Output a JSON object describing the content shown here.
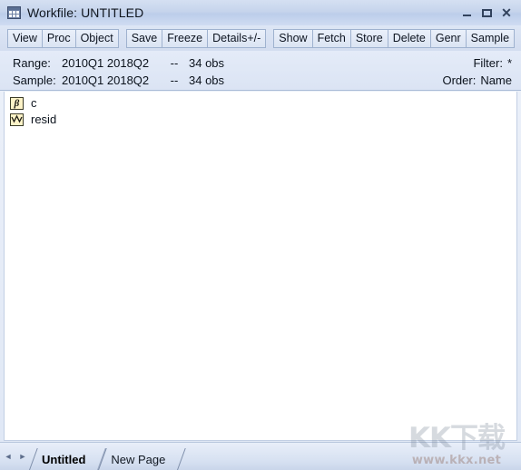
{
  "window": {
    "title": "Workfile: UNTITLED",
    "icon": "workfile-grid-icon",
    "buttons": {
      "minimize": "minimize-icon",
      "maximize": "maximize-icon",
      "close": "close-icon"
    }
  },
  "toolbar": {
    "groups": [
      {
        "buttons": [
          "View",
          "Proc",
          "Object"
        ]
      },
      {
        "buttons": [
          "Save",
          "Freeze",
          "Details+/-"
        ]
      },
      {
        "buttons": [
          "Show",
          "Fetch",
          "Store",
          "Delete",
          "Genr",
          "Sample"
        ]
      }
    ]
  },
  "info": {
    "range": {
      "label": "Range:",
      "dates": "2010Q1 2018Q2",
      "dash": "--",
      "obs": "34 obs"
    },
    "sample": {
      "label": "Sample:",
      "dates": "2010Q1 2018Q2",
      "dash": "--",
      "obs": "34 obs"
    },
    "filter": {
      "label": "Filter:",
      "value": "*"
    },
    "order": {
      "label": "Order:",
      "value": "Name"
    }
  },
  "objects": [
    {
      "name": "c",
      "icon": "coefficient-beta-icon",
      "glyph": "β"
    },
    {
      "name": "resid",
      "icon": "series-line-icon",
      "glyph": ""
    }
  ],
  "tabs": {
    "nav_prev": "◄",
    "nav_next": "►",
    "items": [
      {
        "label": "Untitled",
        "active": true
      },
      {
        "label": "New Page",
        "active": false
      }
    ]
  },
  "watermark": {
    "big": "KK下载",
    "small": "www.kkx.net"
  },
  "colors": {
    "titlebar": "#c6d4ec",
    "toolbar": "#d8e1f2",
    "info_panel": "#e0e8f6",
    "content_bg": "#ffffff",
    "object_icon_fill": "#fdf3c8",
    "border": "#a9bbd6"
  }
}
